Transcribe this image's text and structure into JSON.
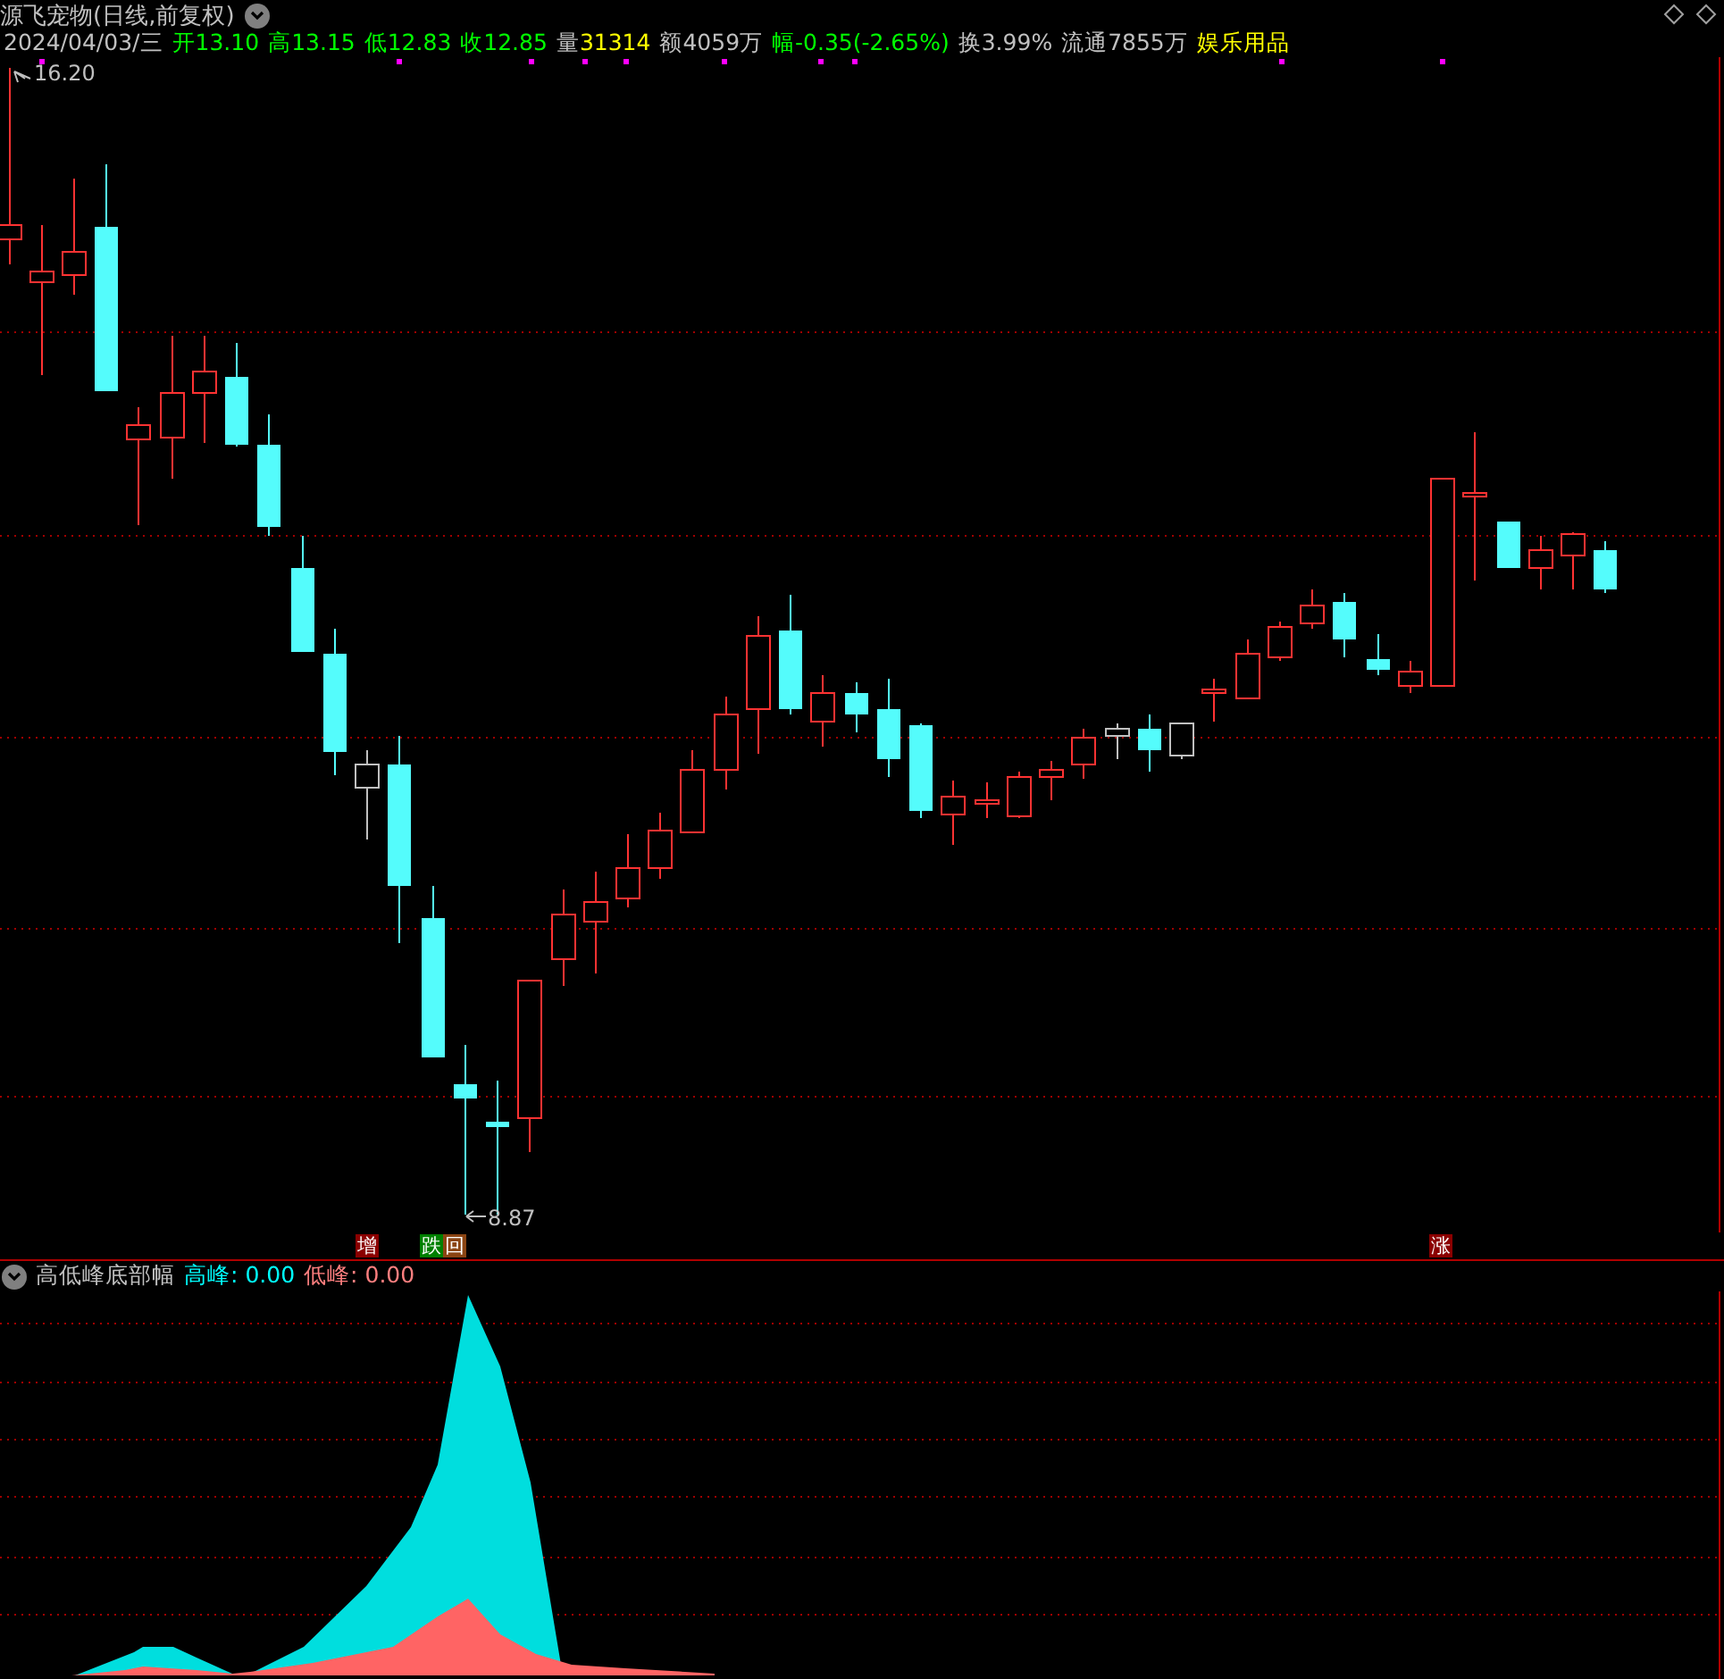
{
  "window": {
    "title": "源飞宠物(日线,前复权)"
  },
  "quote": [
    {
      "kind": "plain",
      "text": "2024/04/03/三",
      "color": "#c0c0c0"
    },
    {
      "kind": "plain",
      "text": "开13.10",
      "color": "#00ff00"
    },
    {
      "kind": "plain",
      "text": "高13.15",
      "color": "#00ff00"
    },
    {
      "kind": "plain",
      "text": "低12.83",
      "color": "#00ff00"
    },
    {
      "kind": "plain",
      "text": "收12.85",
      "color": "#00ff00"
    },
    {
      "kind": "split",
      "label": "量",
      "value": "31314",
      "color": "#ffff00"
    },
    {
      "kind": "plain",
      "text": "额4059万",
      "color": "#c0c0c0"
    },
    {
      "kind": "plain",
      "text": "幅-0.35(-2.65%)",
      "color": "#00ff00"
    },
    {
      "kind": "plain",
      "text": "换3.99%",
      "color": "#c0c0c0"
    },
    {
      "kind": "plain",
      "text": "流通7855万",
      "color": "#c0c0c0"
    },
    {
      "kind": "plain",
      "text": "娱乐用品",
      "color": "#ffff00"
    }
  ],
  "price_labels": {
    "high": "16.20",
    "low": "8.87"
  },
  "signals": [
    {
      "text": "增",
      "color": "#8b0000"
    },
    {
      "text": "跌",
      "color": "#008000"
    },
    {
      "text": "回",
      "color": "#8b4513"
    },
    {
      "text": "涨",
      "color": "#8b0000"
    }
  ],
  "indicator": {
    "title": "高低峰底部幅",
    "values": [
      {
        "label": "高峰:",
        "value": "0.00",
        "color": "#00ffff"
      },
      {
        "label": "低峰:",
        "value": "0.00",
        "color": "#ff7f7f"
      }
    ]
  }
}
